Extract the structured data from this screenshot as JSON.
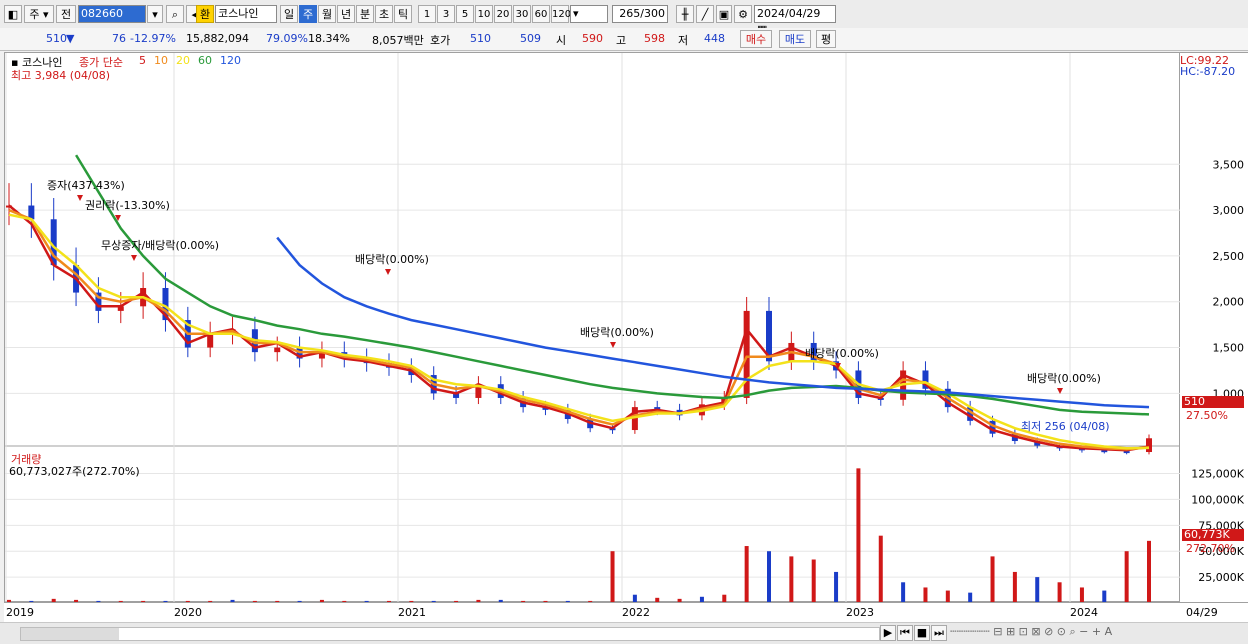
{
  "toolbar": {
    "market": "주",
    "all": "전",
    "code": "082660",
    "currency": "환",
    "name": "코스나인",
    "periods": [
      {
        "label": "일",
        "selected": false
      },
      {
        "label": "주",
        "selected": true
      },
      {
        "label": "월",
        "selected": false
      },
      {
        "label": "년",
        "selected": false
      },
      {
        "label": "분",
        "selected": false
      },
      {
        "label": "초",
        "selected": false
      },
      {
        "label": "틱",
        "selected": false
      }
    ],
    "intervals": [
      "1",
      "3",
      "5",
      "10",
      "20",
      "30",
      "60",
      "120"
    ],
    "count": "265",
    "count_total": "/300",
    "date": "2024/04/29"
  },
  "quote": {
    "price": "510",
    "change_arrow": "▼",
    "change": "76",
    "change_pct": "-12.97%",
    "volume": "15,882,094",
    "vol_ratio": "79.09%",
    "turnover": "18.34%",
    "amount": "8,057백만",
    "hoga_label": "호가",
    "ask": "510",
    "bid": "509",
    "open_label": "시",
    "open": "590",
    "high_label": "고",
    "high": "598",
    "low_label": "저",
    "low": "448",
    "buy_label": "매수",
    "sell_label": "매도",
    "eval_label": "평"
  },
  "legend": {
    "stock": "코스나인",
    "ma_label": "종가 단순",
    "mas": [
      {
        "period": "5",
        "color": "#d01818"
      },
      {
        "period": "10",
        "color": "#f08a1c"
      },
      {
        "period": "20",
        "color": "#f3e21a"
      },
      {
        "period": "60",
        "color": "#2a9a3a"
      },
      {
        "period": "120",
        "color": "#2255dd"
      }
    ],
    "high_label": "최고 3,984 (04/08)",
    "lc": "LC:99.22",
    "hc": "HC:-87.20"
  },
  "annotations": [
    {
      "text": "증자(437.43%)"
    },
    {
      "text": "권리락(-13.30%)"
    },
    {
      "text": "무상증자/배당락(0.00%)"
    },
    {
      "text": "배당락(0.00%)"
    },
    {
      "text": "배당락(0.00%)"
    },
    {
      "text": "배당락(0.00%)"
    },
    {
      "text": "배당락(0.00%)"
    },
    {
      "text": "최저 256 (04/08)"
    }
  ],
  "volume_panel": {
    "title": "거래량",
    "value": "60,773,027주(272.70%)",
    "current_tag": "60,773K",
    "current_pct": "272.70%"
  },
  "price_tag": {
    "value": "510",
    "pct": "27.50%"
  },
  "chart_data": {
    "type": "line",
    "title": "코스나인",
    "x": [
      "2019",
      "2020",
      "2021",
      "2022",
      "2023",
      "2024"
    ],
    "x_end_label": "04/29",
    "price_ticks": [
      "3,500",
      "3,000",
      "2,500",
      "2,000",
      "1,500",
      "1,000"
    ],
    "volume_ticks": [
      "125,000K",
      "100,000K",
      "75,000K",
      "50,000K",
      "25,000K"
    ],
    "ylim": [
      0,
      4000
    ],
    "series": [
      {
        "name": "5",
        "color": "#d01818",
        "values": [
          3050,
          2850,
          2400,
          2250,
          1950,
          1950,
          2100,
          1850,
          1550,
          1650,
          1700,
          1500,
          1550,
          1400,
          1450,
          1380,
          1350,
          1300,
          1250,
          1050,
          1000,
          1100,
          1000,
          900,
          850,
          780,
          680,
          620,
          800,
          820,
          780,
          850,
          900,
          1700,
          1400,
          1500,
          1400,
          1300,
          1000,
          950,
          1200,
          1100,
          900,
          750,
          600,
          530,
          470,
          420,
          400,
          390,
          380,
          420
        ]
      },
      {
        "name": "10",
        "color": "#f08a1c",
        "values": [
          3000,
          2900,
          2500,
          2300,
          2050,
          2000,
          2050,
          1900,
          1650,
          1650,
          1680,
          1550,
          1550,
          1450,
          1450,
          1400,
          1370,
          1320,
          1280,
          1100,
          1050,
          1080,
          1020,
          930,
          880,
          800,
          720,
          660,
          760,
          800,
          780,
          830,
          880,
          1400,
          1400,
          1450,
          1400,
          1320,
          1050,
          980,
          1150,
          1120,
          950,
          800,
          650,
          560,
          500,
          450,
          420,
          400,
          390,
          410
        ]
      },
      {
        "name": "20",
        "color": "#f3e21a",
        "values": [
          2950,
          2900,
          2600,
          2400,
          2150,
          2050,
          2050,
          1950,
          1750,
          1650,
          1650,
          1580,
          1560,
          1500,
          1470,
          1420,
          1390,
          1350,
          1300,
          1150,
          1100,
          1080,
          1040,
          960,
          900,
          830,
          760,
          700,
          740,
          780,
          780,
          810,
          860,
          1150,
          1300,
          1350,
          1350,
          1320,
          1100,
          1030,
          1100,
          1120,
          1000,
          850,
          720,
          620,
          550,
          490,
          450,
          420,
          400,
          405
        ]
      },
      {
        "name": "60",
        "color": "#2a9a3a",
        "values": [
          null,
          null,
          null,
          3600,
          3200,
          2800,
          2500,
          2250,
          2100,
          1950,
          1850,
          1800,
          1740,
          1700,
          1650,
          1620,
          1580,
          1540,
          1500,
          1450,
          1400,
          1350,
          1300,
          1250,
          1200,
          1150,
          1100,
          1060,
          1030,
          1000,
          980,
          960,
          950,
          980,
          1030,
          1060,
          1070,
          1080,
          1060,
          1030,
          1010,
          1000,
          990,
          970,
          940,
          900,
          860,
          820,
          800,
          790,
          780,
          770
        ]
      },
      {
        "name": "120",
        "color": "#2255dd",
        "values": [
          null,
          null,
          null,
          null,
          null,
          null,
          null,
          null,
          null,
          null,
          null,
          null,
          2700,
          2400,
          2200,
          2050,
          1950,
          1870,
          1800,
          1750,
          1700,
          1650,
          1600,
          1550,
          1500,
          1460,
          1420,
          1380,
          1340,
          1300,
          1260,
          1220,
          1180,
          1150,
          1120,
          1100,
          1080,
          1060,
          1050,
          1040,
          1030,
          1020,
          1010,
          990,
          970,
          950,
          930,
          910,
          890,
          870,
          860,
          850
        ]
      }
    ],
    "candles_close": [
      3050,
      2900,
      2400,
      2100,
      1900,
      1950,
      2150,
      1800,
      1500,
      1650,
      1700,
      1450,
      1500,
      1380,
      1450,
      1380,
      1330,
      1280,
      1200,
      1000,
      950,
      1100,
      950,
      850,
      820,
      720,
      620,
      600,
      850,
      820,
      760,
      880,
      950,
      1900,
      1350,
      1550,
      1350,
      1250,
      950,
      930,
      1250,
      1050,
      850,
      700,
      560,
      480,
      430,
      400,
      380,
      370,
      360,
      510
    ],
    "volume": [
      3,
      2,
      4,
      3,
      2,
      2,
      2,
      2,
      2,
      2,
      3,
      2,
      2,
      2,
      3,
      2,
      2,
      2,
      2,
      2,
      2,
      3,
      3,
      2,
      2,
      2,
      2,
      50,
      8,
      5,
      4,
      6,
      8,
      55,
      50,
      45,
      42,
      30,
      130,
      65,
      20,
      15,
      12,
      10,
      45,
      30,
      25,
      20,
      15,
      12,
      50,
      60
    ]
  },
  "bottom": {
    "nav": [
      "▶",
      "⏮",
      "■",
      "⏭"
    ]
  }
}
